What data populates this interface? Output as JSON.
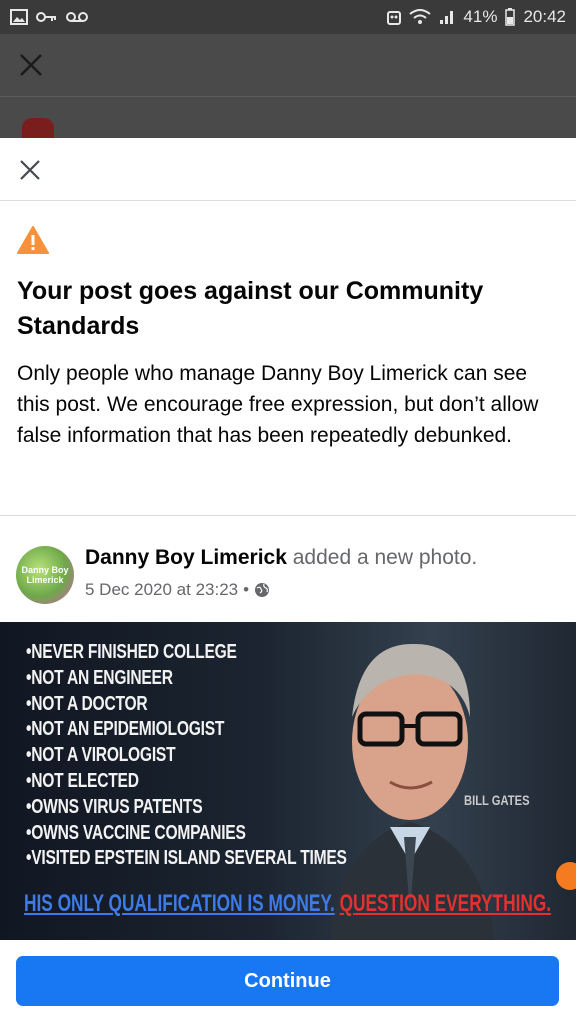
{
  "status_bar": {
    "battery": "41%",
    "time": "20:42"
  },
  "dialog": {
    "headline": "Your post goes against our Community Standards",
    "body": "Only people who manage Danny Boy Limerick can see this post.  We encourage free expression, but don’t allow false information that has been repeatedly debunked."
  },
  "post": {
    "author": "Danny Boy Limerick",
    "action": " added a new photo.",
    "date": "5 Dec 2020 at 23:23",
    "separator": " • ",
    "privacy_icon": "globe-icon",
    "avatar_text": "Danny Boy Limerick",
    "image": {
      "bullets": [
        "NEVER FINISHED COLLEGE",
        "NOT AN ENGINEER",
        "NOT A DOCTOR",
        "NOT AN EPIDEMIOLOGIST",
        "NOT A VIROLOGIST",
        "NOT ELECTED",
        "OWNS VIRUS PATENTS",
        "OWNS VACCINE COMPANIES",
        "VISITED EPSTEIN ISLAND SEVERAL TIMES"
      ],
      "name_tag": "BILL GATES",
      "line1": "HIS ONLY QUALIFICATION IS MONEY.",
      "line2": "QUESTION EVERYTHING."
    }
  },
  "continue_label": "Continue",
  "colors": {
    "accent": "#1877f2",
    "warning": "#f7923a"
  }
}
